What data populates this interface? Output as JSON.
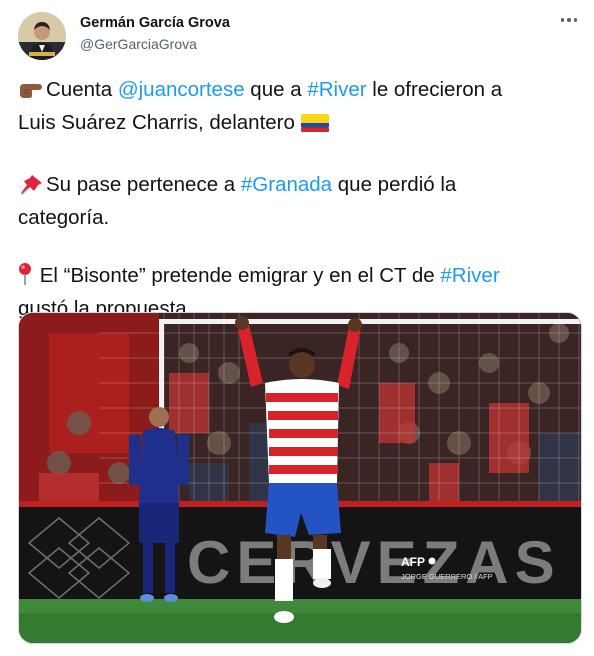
{
  "tweet": {
    "author_name": "Germán García Grova",
    "author_handle": "@GerGarciaGrova",
    "line1_pre": "Cuenta ",
    "line1_mention": "@juancortese",
    "line1_mid": " que a ",
    "line1_hashtag": "#River",
    "line1_post": " le ofrecieron a",
    "line2": "Luis Suárez Charris, delantero ",
    "line3_pre": "Su pase pertenece a ",
    "line3_hashtag": "#Granada",
    "line3_post": " que perdió la",
    "line4": "categoría.",
    "line5_pre": " El “Bisonte” pretende emigrar y en el CT de ",
    "line5_hashtag": "#River",
    "line6": "gustó la propuesta."
  },
  "media": {
    "board_text": "CERVEZAS AL",
    "credit_logo": "AFP",
    "credit_name": "JORGE GUERRERO / AFP"
  },
  "icons": {
    "more": "more-horizontal-icon",
    "pointing": "backhand-index-pointing-right-icon",
    "flag": "colombia-flag-icon",
    "pushpin": "pushpin-icon",
    "round_pushpin": "round-pushpin-icon"
  },
  "colors": {
    "link": "#1d9bf0",
    "secondary_text": "#536471",
    "primary_text": "#0f1419"
  }
}
